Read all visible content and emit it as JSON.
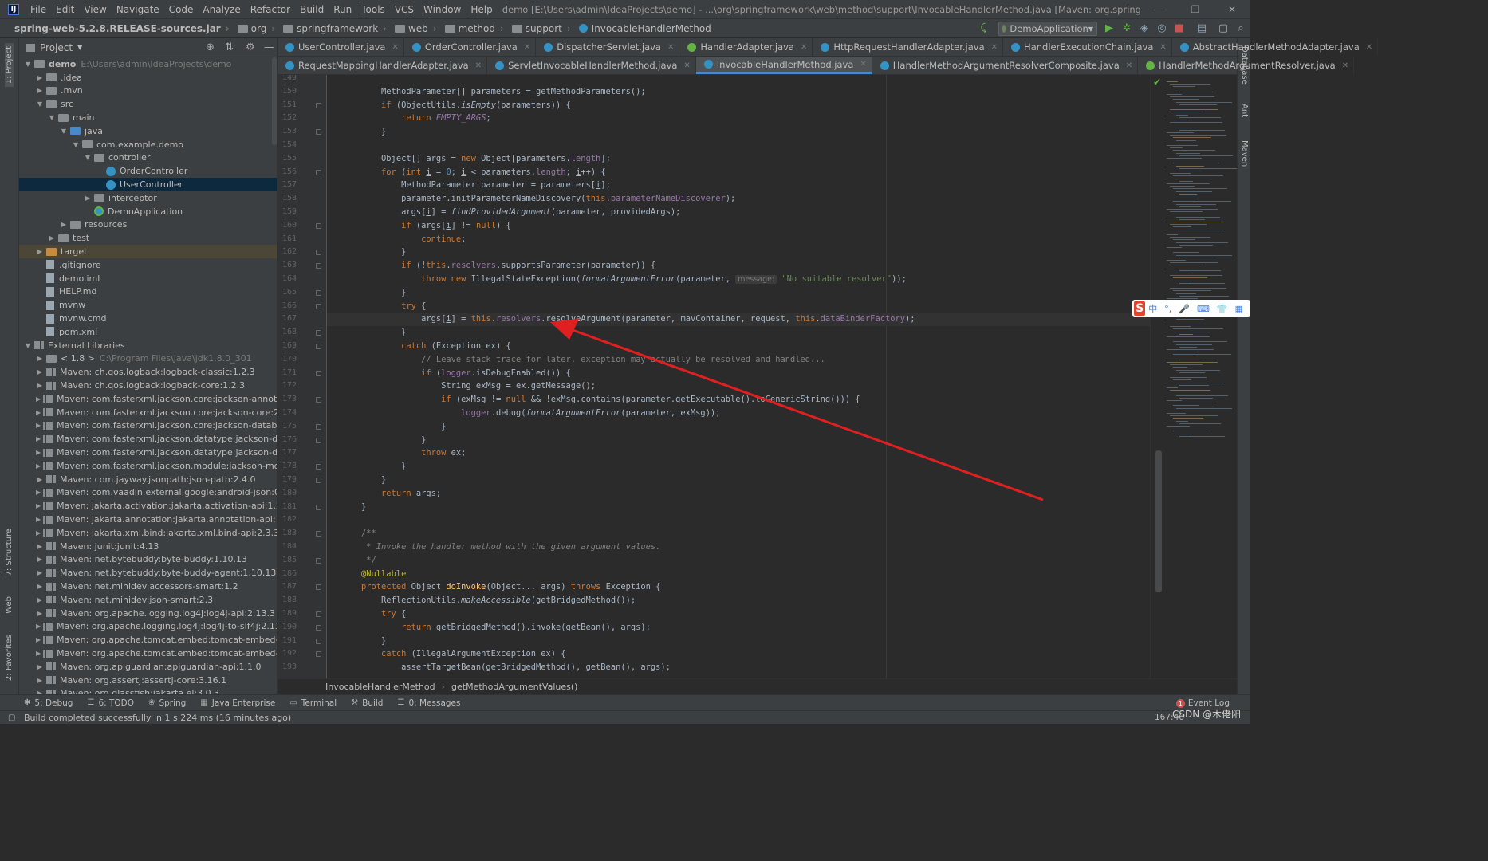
{
  "menubar": {
    "items": [
      "File",
      "Edit",
      "View",
      "Navigate",
      "Code",
      "Analyze",
      "Refactor",
      "Build",
      "Run",
      "Tools",
      "VCS",
      "Window",
      "Help"
    ],
    "underline": [
      "F",
      "E",
      "V",
      "N",
      "C",
      "z",
      "R",
      "B",
      "u",
      "T",
      "S",
      "W",
      "H"
    ],
    "title": "demo [E:\\Users\\admin\\IdeaProjects\\demo] - ...\\org\\springframework\\web\\method\\support\\InvocableHandlerMethod.java [Maven: org.springframework:spring-web:5.2.8.RELEASE]"
  },
  "navbar": {
    "crumbs": [
      "spring-web-5.2.8.RELEASE-sources.jar",
      "org",
      "springframework",
      "web",
      "method",
      "support",
      "InvocableHandlerMethod"
    ],
    "run_config": "DemoApplication"
  },
  "left_tool_tabs": [
    "1: Project",
    "7: Structure",
    "Web",
    "2: Favorites"
  ],
  "right_tool_tabs": [
    "Database",
    "Ant",
    "Maven"
  ],
  "project": {
    "header": "Project",
    "rows": [
      {
        "d": 0,
        "t": "▼",
        "i": "f-grey",
        "label": "demo",
        "bold": true,
        "extra": "E:\\Users\\admin\\IdeaProjects\\demo"
      },
      {
        "d": 1,
        "t": "▶",
        "i": "f-grey",
        "label": ".idea"
      },
      {
        "d": 1,
        "t": "▶",
        "i": "f-grey",
        "label": ".mvn"
      },
      {
        "d": 1,
        "t": "▼",
        "i": "f-grey",
        "label": "src"
      },
      {
        "d": 2,
        "t": "▼",
        "i": "f-grey",
        "label": "main"
      },
      {
        "d": 3,
        "t": "▼",
        "i": "f-blue",
        "label": "java"
      },
      {
        "d": 4,
        "t": "▼",
        "i": "f-pkg",
        "label": "com.example.demo"
      },
      {
        "d": 5,
        "t": "▼",
        "i": "f-pkg",
        "label": "controller"
      },
      {
        "d": 6,
        "t": "",
        "i": "class",
        "label": "OrderController"
      },
      {
        "d": 6,
        "t": "",
        "i": "class",
        "label": "UserController",
        "sel": true
      },
      {
        "d": 5,
        "t": "▶",
        "i": "f-pkg",
        "label": "interceptor"
      },
      {
        "d": 5,
        "t": "",
        "i": "app",
        "label": "DemoApplication"
      },
      {
        "d": 3,
        "t": "▶",
        "i": "f-grey",
        "label": "resources"
      },
      {
        "d": 2,
        "t": "▶",
        "i": "f-grey",
        "label": "test"
      },
      {
        "d": 1,
        "t": "▶",
        "i": "f-orange",
        "label": "target",
        "hl": true
      },
      {
        "d": 1,
        "t": "",
        "i": "file",
        "label": ".gitignore"
      },
      {
        "d": 1,
        "t": "",
        "i": "file",
        "label": "demo.iml"
      },
      {
        "d": 1,
        "t": "",
        "i": "file",
        "label": "HELP.md"
      },
      {
        "d": 1,
        "t": "",
        "i": "file",
        "label": "mvnw"
      },
      {
        "d": 1,
        "t": "",
        "i": "file",
        "label": "mvnw.cmd"
      },
      {
        "d": 1,
        "t": "",
        "i": "file",
        "label": "pom.xml"
      },
      {
        "d": 0,
        "t": "▼",
        "i": "lib",
        "label": "External Libraries"
      },
      {
        "d": 1,
        "t": "▶",
        "i": "f-grey",
        "label": "< 1.8 >",
        "extra": "C:\\Program Files\\Java\\jdk1.8.0_301"
      },
      {
        "d": 1,
        "t": "▶",
        "i": "lib",
        "label": "Maven: ch.qos.logback:logback-classic:1.2.3"
      },
      {
        "d": 1,
        "t": "▶",
        "i": "lib",
        "label": "Maven: ch.qos.logback:logback-core:1.2.3"
      },
      {
        "d": 1,
        "t": "▶",
        "i": "lib",
        "label": "Maven: com.fasterxml.jackson.core:jackson-annotations:"
      },
      {
        "d": 1,
        "t": "▶",
        "i": "lib",
        "label": "Maven: com.fasterxml.jackson.core:jackson-core:2.11.1"
      },
      {
        "d": 1,
        "t": "▶",
        "i": "lib",
        "label": "Maven: com.fasterxml.jackson.core:jackson-databind:2.1"
      },
      {
        "d": 1,
        "t": "▶",
        "i": "lib",
        "label": "Maven: com.fasterxml.jackson.datatype:jackson-datatype"
      },
      {
        "d": 1,
        "t": "▶",
        "i": "lib",
        "label": "Maven: com.fasterxml.jackson.datatype:jackson-datatype"
      },
      {
        "d": 1,
        "t": "▶",
        "i": "lib",
        "label": "Maven: com.fasterxml.jackson.module:jackson-module-p"
      },
      {
        "d": 1,
        "t": "▶",
        "i": "lib",
        "label": "Maven: com.jayway.jsonpath:json-path:2.4.0"
      },
      {
        "d": 1,
        "t": "▶",
        "i": "lib",
        "label": "Maven: com.vaadin.external.google:android-json:0.0.201"
      },
      {
        "d": 1,
        "t": "▶",
        "i": "lib",
        "label": "Maven: jakarta.activation:jakarta.activation-api:1.2.2"
      },
      {
        "d": 1,
        "t": "▶",
        "i": "lib",
        "label": "Maven: jakarta.annotation:jakarta.annotation-api:1.3.5"
      },
      {
        "d": 1,
        "t": "▶",
        "i": "lib",
        "label": "Maven: jakarta.xml.bind:jakarta.xml.bind-api:2.3.3"
      },
      {
        "d": 1,
        "t": "▶",
        "i": "lib",
        "label": "Maven: junit:junit:4.13"
      },
      {
        "d": 1,
        "t": "▶",
        "i": "lib",
        "label": "Maven: net.bytebuddy:byte-buddy:1.10.13"
      },
      {
        "d": 1,
        "t": "▶",
        "i": "lib",
        "label": "Maven: net.bytebuddy:byte-buddy-agent:1.10.13"
      },
      {
        "d": 1,
        "t": "▶",
        "i": "lib",
        "label": "Maven: net.minidev:accessors-smart:1.2"
      },
      {
        "d": 1,
        "t": "▶",
        "i": "lib",
        "label": "Maven: net.minidev:json-smart:2.3"
      },
      {
        "d": 1,
        "t": "▶",
        "i": "lib",
        "label": "Maven: org.apache.logging.log4j:log4j-api:2.13.3"
      },
      {
        "d": 1,
        "t": "▶",
        "i": "lib",
        "label": "Maven: org.apache.logging.log4j:log4j-to-slf4j:2.13.3"
      },
      {
        "d": 1,
        "t": "▶",
        "i": "lib",
        "label": "Maven: org.apache.tomcat.embed:tomcat-embed-core:9"
      },
      {
        "d": 1,
        "t": "▶",
        "i": "lib",
        "label": "Maven: org.apache.tomcat.embed:tomcat-embed-webs"
      },
      {
        "d": 1,
        "t": "▶",
        "i": "lib",
        "label": "Maven: org.apiguardian:apiguardian-api:1.1.0"
      },
      {
        "d": 1,
        "t": "▶",
        "i": "lib",
        "label": "Maven: org.assertj:assertj-core:3.16.1"
      },
      {
        "d": 1,
        "t": "▶",
        "i": "lib",
        "label": "Maven: org.glassfish:jakarta.el:3.0.3"
      }
    ]
  },
  "tabs_row1": [
    {
      "label": "UserController.java",
      "kind": "class"
    },
    {
      "label": "OrderController.java",
      "kind": "class"
    },
    {
      "label": "DispatcherServlet.java",
      "kind": "class"
    },
    {
      "label": "HandlerAdapter.java",
      "kind": "iface"
    },
    {
      "label": "HttpRequestHandlerAdapter.java",
      "kind": "class"
    },
    {
      "label": "HandlerExecutionChain.java",
      "kind": "class"
    },
    {
      "label": "AbstractHandlerMethodAdapter.java",
      "kind": "class"
    }
  ],
  "tabs_row2": [
    {
      "label": "RequestMappingHandlerAdapter.java",
      "kind": "class"
    },
    {
      "label": "ServletInvocableHandlerMethod.java",
      "kind": "class"
    },
    {
      "label": "InvocableHandlerMethod.java",
      "kind": "class",
      "active": true
    },
    {
      "label": "HandlerMethodArgumentResolverComposite.java",
      "kind": "class"
    },
    {
      "label": "HandlerMethodArgumentResolver.java",
      "kind": "iface"
    }
  ],
  "editor": {
    "first_line": 149,
    "current_line": 167,
    "lines": [
      "",
      "\t\t[[MethodParameter[] parameters = getMethodParameters();]]",
      "\t\t{kw:if} (ObjectUtils.{st:isEmpty}(parameters)) {",
      "\t\t\t{kw:return} {sc:EMPTY_ARGS};",
      "\t\t}",
      "",
      "\t\tObject[] args = {kw:new} Object[parameters.{fld:length}];",
      "\t\t{kw:for} ({kw:int} {u:i} = {num:0}; {u:i} < parameters.{fld:length}; {u:i}++) {",
      "\t\t\tMethodParameter parameter = parameters[{u:i}];",
      "\t\t\tparameter.initParameterNameDiscovery({kw:this}.{fld:parameterNameDiscoverer});",
      "\t\t\targs[{u:i}] = {st:findProvidedArgument}(parameter, providedArgs);",
      "\t\t\t{kw:if} (args[{u:i}] != {kw:null}) {",
      "\t\t\t\t{kw:continue};",
      "\t\t\t}",
      "\t\t\t{kw:if} (!{kw:this}.{fld:resolvers}.supportsParameter(parameter)) {",
      "\t\t\t\t{kw:throw} {kw:new} IllegalStateException({st:formatArgumentError}(parameter, {hint:message:} {str:\"No suitable resolver\"}));",
      "\t\t\t}",
      "\t\t\t{kw:try} {",
      "\t\t\t\targs[{u:i}] = {kw:this}.{fld:resolvers}.resolveArgument(parameter, mavContainer, request, {kw:this}.{fld:dataBinderFactory});",
      "\t\t\t}",
      "\t\t\t{kw:catch} (Exception ex) {",
      "\t\t\t\t{cmt:// Leave stack trace for later, exception may actually be resolved and handled...}",
      "\t\t\t\t{kw:if} ({fld:logger}.isDebugEnabled()) {",
      "\t\t\t\t\tString exMsg = ex.getMessage();",
      "\t\t\t\t\t{kw:if} (exMsg != {kw:null} && !exMsg.contains(parameter.getExecutable().toGenericString())) {",
      "\t\t\t\t\t\t{fld:logger}.debug({st:formatArgumentError}(parameter, exMsg));",
      "\t\t\t\t\t}",
      "\t\t\t\t}",
      "\t\t\t\t{kw:throw} ex;",
      "\t\t\t}",
      "\t\t}",
      "\t\t{kw:return} args;",
      "\t}",
      "",
      "\t{cmt:/**}",
      "\t{cmtit: * Invoke the handler method with the given argument values.}",
      "\t{cmt: */}",
      "\t{ann:@Nullable}",
      "\t{kw:protected} Object {fn:doInvoke}(Object... args) {kw:throws} Exception {",
      "\t\tReflectionUtils.{st:makeAccessible}(getBridgedMethod());",
      "\t\t{kw:try} {",
      "\t\t\t{kw:return} getBridgedMethod().invoke(getBean(), args);",
      "\t\t}",
      "\t\t{kw:catch} (IllegalArgumentException ex) {",
      "\t\t\tassertTargetBean(getBridgedMethod(), getBean(), args);"
    ]
  },
  "breadcrumb": [
    "InvocableHandlerMethod",
    "getMethodArgumentValues()"
  ],
  "tool_windows": [
    {
      "icon": "bug-icon",
      "glyph": "✱",
      "label": "5: Debug"
    },
    {
      "icon": "todo-icon",
      "glyph": "☰",
      "label": "6: TODO"
    },
    {
      "icon": "spring-icon",
      "glyph": "❀",
      "label": "Spring"
    },
    {
      "icon": "enterprise-icon",
      "glyph": "▦",
      "label": "Java Enterprise"
    },
    {
      "icon": "terminal-icon",
      "glyph": "▭",
      "label": "Terminal"
    },
    {
      "icon": "build-icon",
      "glyph": "⚒",
      "label": "Build"
    },
    {
      "icon": "messages-icon",
      "glyph": "☰",
      "label": "0: Messages"
    }
  ],
  "event_log": {
    "count": "1",
    "label": "Event Log"
  },
  "status": {
    "message": "Build completed successfully in 1 s 224 ms (16 minutes ago)",
    "caret": "167:46"
  },
  "watermark": "CSDN @木佬阳",
  "ime": {
    "logo": "S",
    "items": [
      "中",
      "°,",
      "🎤",
      "⌨",
      "👕",
      "▦"
    ]
  },
  "colors": {
    "accent": "#4a88c7",
    "arrow": "#e02020",
    "selection": "#0d293e"
  }
}
